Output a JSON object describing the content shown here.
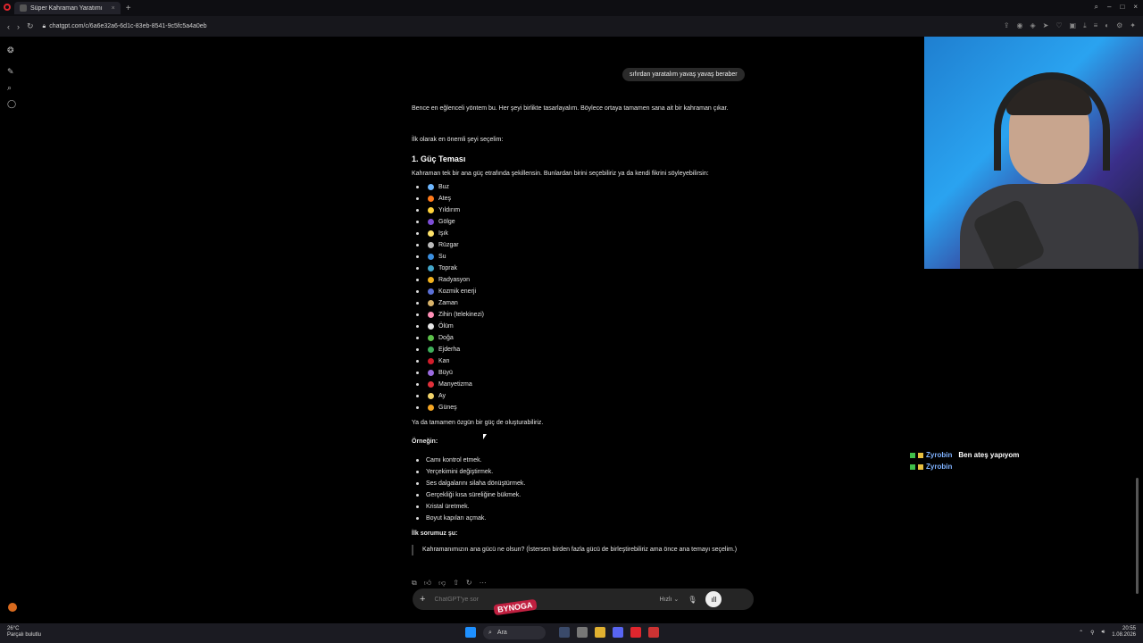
{
  "browser": {
    "tab_title": "Süper Kahraman Yaratımı",
    "url": "chatgpt.com/c/6a6e32a6-6d1c-83eb-8541-9c5fc5a4a0eb"
  },
  "chat": {
    "user_message": "sıfırdan yaratalım yavaş yavaş beraber",
    "intro": "Bence en eğlenceli yöntem bu. Her şeyi birlikte tasarlayalım. Böylece ortaya tamamen sana ait bir kahraman çıkar.",
    "first_choice": "İlk olarak en önemli şeyi seçelim:",
    "section_title": "1. Güç Teması",
    "section_desc": "Kahraman tek bir ana güç etrafında şekillensin. Bunlardan birini seçebiliriz ya da kendi fikrini söyleyebilirsin:",
    "powers": [
      {
        "label": "Buz",
        "icon": "snowflake-icon",
        "color": "#6fb8ff"
      },
      {
        "label": "Ateş",
        "icon": "fire-icon",
        "color": "#ff7a1a"
      },
      {
        "label": "Yıldırım",
        "icon": "lightning-icon",
        "color": "#ffd23a"
      },
      {
        "label": "Gölge",
        "icon": "shadow-orb-icon",
        "color": "#7c4dd6"
      },
      {
        "label": "Işık",
        "icon": "lightbulb-icon",
        "color": "#ffe36a"
      },
      {
        "label": "Rüzgar",
        "icon": "tornado-icon",
        "color": "#bbbbbb"
      },
      {
        "label": "Su",
        "icon": "wave-icon",
        "color": "#3b8fe0"
      },
      {
        "label": "Toprak",
        "icon": "earth-icon",
        "color": "#43a6c9"
      },
      {
        "label": "Radyasyon",
        "icon": "radiation-icon",
        "color": "#f2b21e"
      },
      {
        "label": "Kozmik enerji",
        "icon": "galaxy-icon",
        "color": "#5a6fd6"
      },
      {
        "label": "Zaman",
        "icon": "hourglass-icon",
        "color": "#d9b36a"
      },
      {
        "label": "Zihin (telekinezi)",
        "icon": "brain-icon",
        "color": "#ff8fb6"
      },
      {
        "label": "Ölüm",
        "icon": "skull-icon",
        "color": "#e6e6e6"
      },
      {
        "label": "Doğa",
        "icon": "plant-icon",
        "color": "#5cc04a"
      },
      {
        "label": "Ejderha",
        "icon": "dragon-icon",
        "color": "#3fae5a"
      },
      {
        "label": "Kan",
        "icon": "blood-drop-icon",
        "color": "#d11c2a"
      },
      {
        "label": "Büyü",
        "icon": "magic-icon",
        "color": "#9a6adf"
      },
      {
        "label": "Manyetizma",
        "icon": "magnet-icon",
        "color": "#e0303a"
      },
      {
        "label": "Ay",
        "icon": "moon-icon",
        "color": "#f2d36a"
      },
      {
        "label": "Güneş",
        "icon": "sun-icon",
        "color": "#f5a623"
      }
    ],
    "custom_power": "Ya da tamamen özgün bir güç de oluşturabiliriz.",
    "examples_title": "Örneğin:",
    "examples": [
      "Camı kontrol etmek.",
      "Yerçekimini değiştirmek.",
      "Ses dalgalarını silaha dönüştürmek.",
      "Gerçekliği kısa süreliğine bükmek.",
      "Kristal üretmek.",
      "Boyut kapıları açmak."
    ],
    "question_title": "İlk sorumuz şu:",
    "question": "Kahramanımızın ana gücü ne olsun? (İstersen birden fazla gücü de birleştirebiliriz ama önce ana temayı seçelim.)"
  },
  "composer": {
    "placeholder": "ChatGPT'ye sor",
    "mode": "Hızlı"
  },
  "stream_chat": [
    {
      "user": "Zyrobin",
      "message": "Ben ateş yapıyom"
    },
    {
      "user": "Zyrobin",
      "message": ""
    }
  ],
  "overlay": {
    "logo_text": "BYNOGA"
  },
  "taskbar": {
    "weather_temp": "26°C",
    "weather_desc": "Parçalı bulutlu",
    "search_label": "Ara",
    "time": "20:55",
    "date": "1.08.2026"
  }
}
